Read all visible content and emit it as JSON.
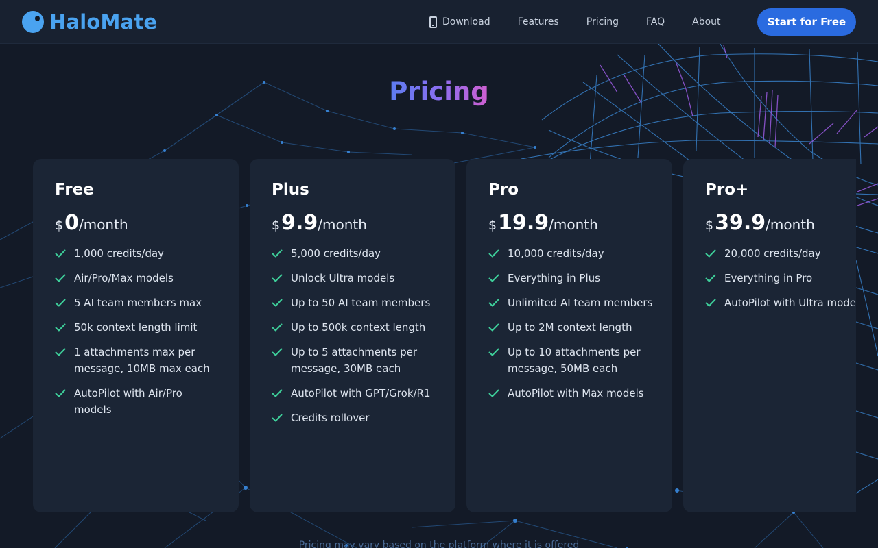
{
  "brand": {
    "name": "HaloMate",
    "accent": "#4aa3f0"
  },
  "nav": {
    "items": [
      {
        "label": "Download",
        "icon": "phone-icon"
      },
      {
        "label": "Features"
      },
      {
        "label": "Pricing"
      },
      {
        "label": "FAQ"
      },
      {
        "label": "About"
      }
    ],
    "cta_label": "Start for Free",
    "cta_color": "#2a6be0"
  },
  "title": "Pricing",
  "currency": "$",
  "period": "/month",
  "plans": [
    {
      "name": "Free",
      "price": "0",
      "features": [
        "1,000 credits/day",
        "Air/Pro/Max models",
        "5 AI team members max",
        "50k context length limit",
        "1 attachments max per message, 10MB max each",
        "AutoPilot with Air/Pro models"
      ]
    },
    {
      "name": "Plus",
      "price": "9.9",
      "features": [
        "5,000 credits/day",
        "Unlock Ultra models",
        "Up to 50 AI team members",
        "Up to 500k context length",
        "Up to 5 attachments per message, 30MB each",
        "AutoPilot with GPT/Grok/R1",
        "Credits rollover"
      ]
    },
    {
      "name": "Pro",
      "price": "19.9",
      "features": [
        "10,000 credits/day",
        "Everything in Plus",
        "Unlimited AI team members",
        "Up to 2M context length",
        "Up to 10 attachments per message, 50MB each",
        "AutoPilot with Max models"
      ]
    },
    {
      "name": "Pro+",
      "price": "39.9",
      "features": [
        "20,000 credits/day",
        "Everything in Pro",
        "AutoPilot with Ultra models"
      ]
    }
  ],
  "footnote": "Pricing may vary based on the platform where it is offered",
  "colors": {
    "check": "#3ecf9a",
    "card_bg": "#1b2535",
    "page_bg": "#131a27"
  }
}
